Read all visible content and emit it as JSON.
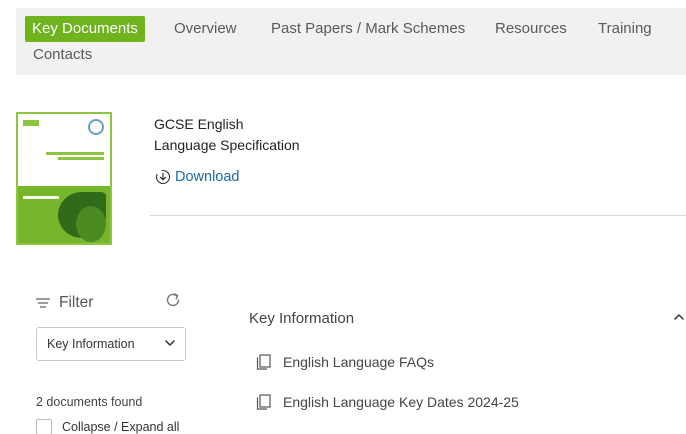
{
  "tabs": [
    {
      "label": "Key Documents",
      "active": true
    },
    {
      "label": "Overview",
      "active": false
    },
    {
      "label": "Past Papers / Mark Schemes",
      "active": false
    },
    {
      "label": "Resources",
      "active": false
    },
    {
      "label": "Training",
      "active": false
    },
    {
      "label": "Contacts",
      "active": false
    }
  ],
  "document": {
    "title_line1": "GCSE English",
    "title_line2": "Language Specification",
    "download_label": "Download"
  },
  "filter": {
    "label": "Filter",
    "selected_option": "Key Information",
    "documents_found": "2 documents found",
    "collapse_label": "Collapse / Expand all"
  },
  "section": {
    "title": "Key Information",
    "items": [
      {
        "label": "English Language FAQs"
      },
      {
        "label": "English Language Key Dates 2024-25"
      }
    ]
  },
  "colors": {
    "accent_green": "#6fb31f",
    "link_blue": "#1a6aa8",
    "tabbar_bg": "#f1f1f1"
  },
  "icons": [
    "download-icon",
    "filter-icon",
    "refresh-icon",
    "chevron-down-icon",
    "chevron-up-icon",
    "document-icon"
  ]
}
